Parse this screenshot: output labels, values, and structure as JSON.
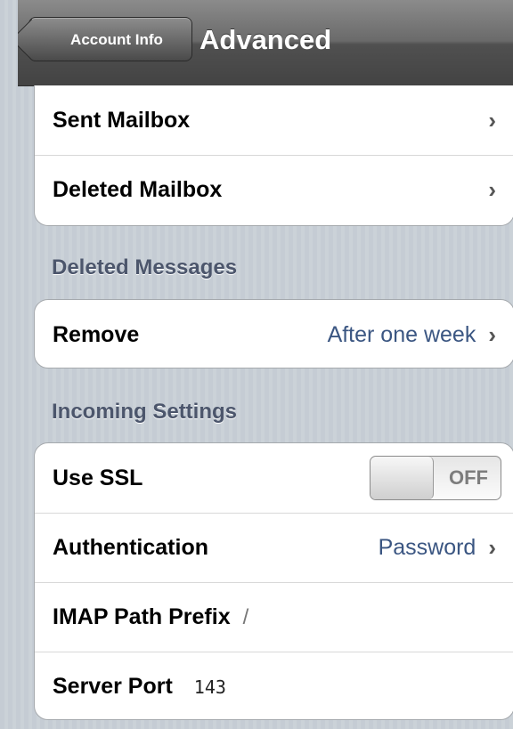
{
  "navbar": {
    "back_label": "Account Info",
    "title": "Advanced"
  },
  "mailboxes": [
    {
      "label": "Sent Mailbox",
      "chevron": "›"
    },
    {
      "label": "Deleted Mailbox",
      "chevron": "›"
    }
  ],
  "deleted_messages": {
    "header": "Deleted Messages",
    "remove": {
      "label": "Remove",
      "value": "After one week",
      "chevron": "›"
    }
  },
  "incoming": {
    "header": "Incoming Settings",
    "ssl": {
      "label": "Use SSL",
      "toggle": "OFF"
    },
    "auth": {
      "label": "Authentication",
      "value": "Password",
      "chevron": "›"
    },
    "imap_prefix": {
      "label": "IMAP Path Prefix",
      "value": "/"
    },
    "server_port": {
      "label": "Server Port",
      "value": "143"
    }
  }
}
